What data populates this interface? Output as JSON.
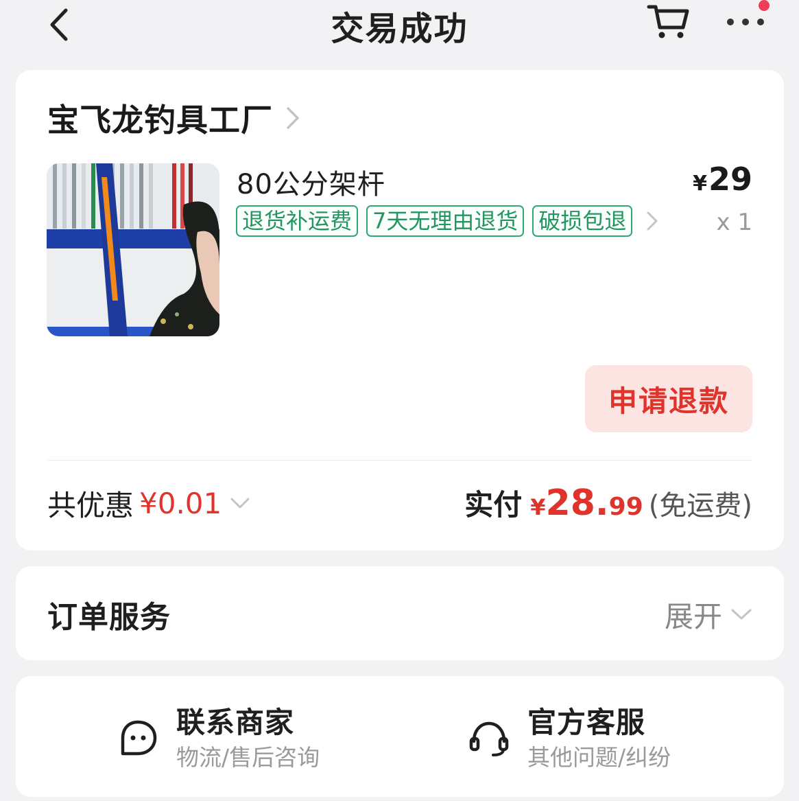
{
  "header": {
    "title": "交易成功",
    "back_icon": "chevron-left-icon",
    "cart_icon": "cart-icon",
    "more_icon": "more-dots-icon",
    "notify_color": "#f03e56"
  },
  "order": {
    "shop_name": "宝飞龙钓具工厂",
    "product": {
      "title": "80公分架杆",
      "price_symbol": "¥",
      "price": "29",
      "quantity": "x 1",
      "tags": [
        "退货补运费",
        "7天无理由退货",
        "破损包退"
      ]
    },
    "refund_button": "申请退款",
    "discount_label": "共优惠",
    "discount_value": "¥0.01",
    "paid_label": "实付",
    "paid_symbol": "¥",
    "paid_int": "28.",
    "paid_dec": "99",
    "paid_note": "(免运费)"
  },
  "service": {
    "title": "订单服务",
    "expand_label": "展开"
  },
  "contact": {
    "merchant_title": "联系商家",
    "merchant_sub": "物流/售后咨询",
    "official_title": "官方客服",
    "official_sub": "其他问题/纠纷"
  },
  "colors": {
    "accent_red": "#e0332c",
    "tag_green": "#23965f",
    "background": "#f2f2f5"
  }
}
